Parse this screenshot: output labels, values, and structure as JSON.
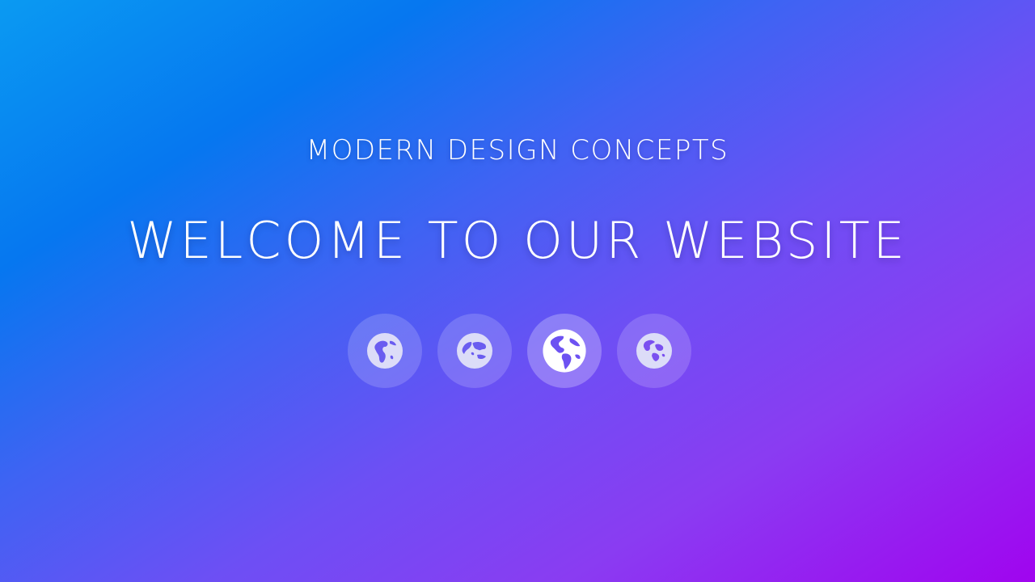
{
  "hero": {
    "subtitle": "MODERN DESIGN CONCEPTS",
    "title": "WELCOME TO OUR WEBSITE"
  },
  "icons": [
    {
      "name": "globe-africa-icon",
      "active": false
    },
    {
      "name": "globe-asia-icon",
      "active": false
    },
    {
      "name": "globe-americas-icon",
      "active": true
    },
    {
      "name": "globe-europe-icon",
      "active": false
    }
  ],
  "colors": {
    "gradient_start": "#0a9af2",
    "gradient_mid": "#6d4ff4",
    "gradient_end": "#a004ef",
    "text": "#ffffff",
    "icon_inactive": "#dcdcf8",
    "icon_active": "#ffffff"
  }
}
